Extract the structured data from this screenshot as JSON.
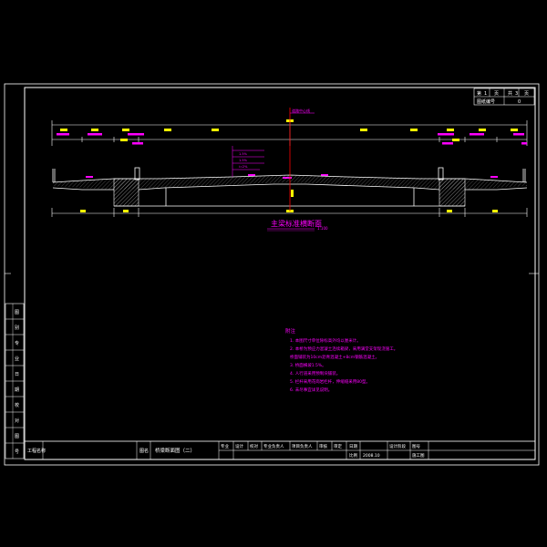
{
  "colors": {
    "background": "#000000",
    "frame": "#ffffff",
    "annotation": "#ff00ff",
    "dimension": "#ffff00",
    "centerline": "#ff0000",
    "axis": "#00ffff",
    "structure": "#ffffff"
  },
  "title_block": {
    "sheet_labels": [
      "第",
      "页",
      "共",
      "页"
    ],
    "sheet_values": [
      "1",
      "3"
    ],
    "drawing_no_label": "图纸编号",
    "drawing_no_value": "0",
    "project_label": "工程名称",
    "drawing_name_label": "图名",
    "drawing_name": "桥梁断面图（二）",
    "signatures": [
      "专业",
      "设计",
      "校对",
      "专业负责人",
      "项目负责人",
      "审核",
      "审定"
    ],
    "date_label": "日期",
    "date_value": "2008.10",
    "stage_label": "设计阶段",
    "scale_label": "比例",
    "map_no_label": "图号",
    "map_no_value": "施工图"
  },
  "left_strip": {
    "labels": [
      "图",
      "别",
      "专",
      "业",
      "日",
      "期",
      "校",
      "对",
      "图",
      "号"
    ]
  },
  "drawing": {
    "section_title": "主梁标准横断面",
    "scale_note": "1:100",
    "centerline_label": "道路中心线",
    "slope_notes": [
      "1.5%",
      "1.5%"
    ],
    "cross_slope_label": "i=2%"
  },
  "notes": {
    "heading": "附注",
    "items": [
      "1. 本图尺寸单位除标高外均以厘米计。",
      "2. 本桥为预应力混凝土连续箱梁，采用满堂支架现浇施工。",
      "   桥面铺装为10cm沥青混凝土+8cm钢筋混凝土。",
      "3. 桥面横坡1.5%。",
      "4. 人行道采用预制块铺装。",
      "5. 栏杆采用花岗岩栏杆，伸缩缝采用80型。",
      "6. 未尽事宜详见说明。"
    ]
  }
}
